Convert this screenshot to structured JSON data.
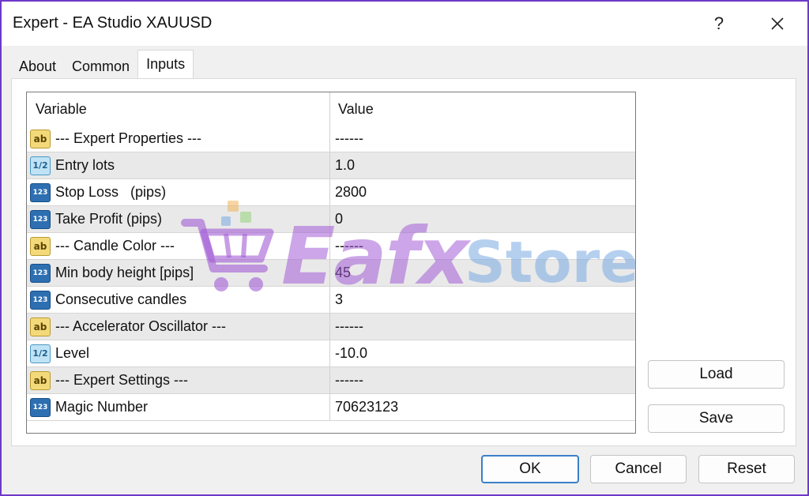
{
  "window": {
    "title": "Expert - EA Studio XAUUSD",
    "help_label": "?",
    "close_label": "✕"
  },
  "tabs": [
    {
      "label": "About"
    },
    {
      "label": "Common"
    },
    {
      "label": "Inputs",
      "active": true
    }
  ],
  "grid": {
    "columns": {
      "variable": "Variable",
      "value": "Value"
    },
    "rows": [
      {
        "icon": "ab",
        "variable": "--- Expert Properties ---",
        "value": "------"
      },
      {
        "icon": "1/2",
        "variable": "Entry lots",
        "value": "1.0"
      },
      {
        "icon": "123",
        "variable": "Stop Loss   (pips)",
        "value": "2800"
      },
      {
        "icon": "123",
        "variable": "Take Profit (pips)",
        "value": "0"
      },
      {
        "icon": "ab",
        "variable": "--- Candle Color ---",
        "value": "------"
      },
      {
        "icon": "123",
        "variable": "Min body height [pips]",
        "value": "45"
      },
      {
        "icon": "123",
        "variable": "Consecutive candles",
        "value": "3"
      },
      {
        "icon": "ab",
        "variable": "--- Accelerator Oscillator ---",
        "value": "------"
      },
      {
        "icon": "1/2",
        "variable": "Level",
        "value": "-10.0"
      },
      {
        "icon": "ab",
        "variable": "--- Expert Settings ---",
        "value": "------"
      },
      {
        "icon": "123",
        "variable": "Magic Number",
        "value": "70623123"
      }
    ]
  },
  "side_buttons": {
    "load": "Load",
    "save": "Save"
  },
  "footer_buttons": {
    "ok": "OK",
    "cancel": "Cancel",
    "reset": "Reset"
  },
  "watermark": {
    "part1": "Eafx",
    "part2": "Store"
  },
  "colors": {
    "window_border": "#6d39c8",
    "ok_border": "#3a80c9",
    "watermark_purple": "#a25cd6",
    "watermark_blue": "#78aae1"
  }
}
